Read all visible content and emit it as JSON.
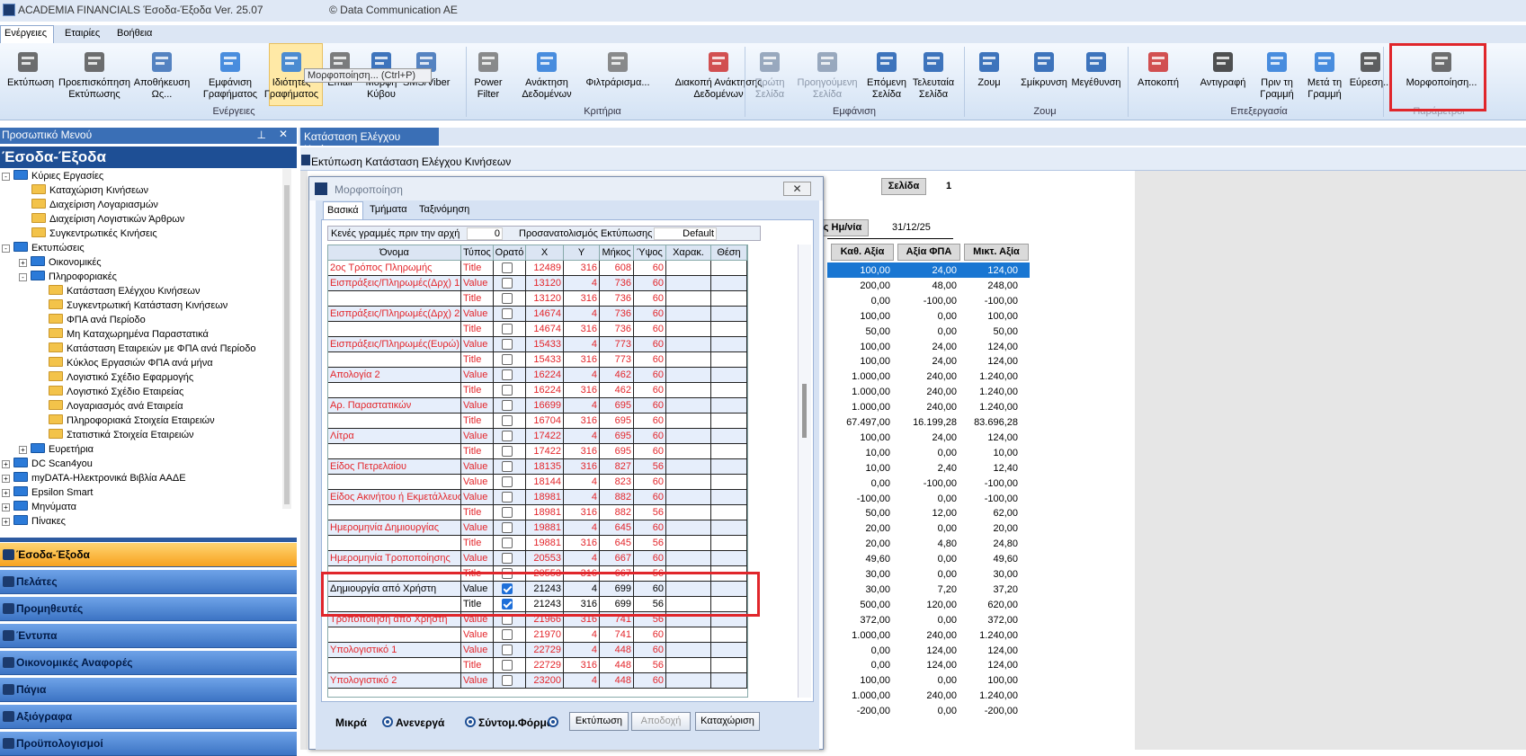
{
  "titlebar": {
    "title": "ACADEMIA FINANCIALS Έσοδα-Έξοδα Ver. 25.07",
    "copyright": "© Data Communication AE"
  },
  "menu": [
    "Ενέργειες",
    "Εταιρίες",
    "Βοήθεια"
  ],
  "ribbon": {
    "buttons": [
      {
        "label1": "Εκτύπωση",
        "label2": "",
        "icon": "printer-icon"
      },
      {
        "label1": "Προεπισκόπηση",
        "label2": "Εκτύπωσης",
        "icon": "print-preview-icon"
      },
      {
        "label1": "Αποθήκευση",
        "label2": "Ως...",
        "icon": "save-as-icon"
      },
      {
        "label1": "Εμφάνιση",
        "label2": "Γραφήματος",
        "icon": "bar-chart-icon"
      },
      {
        "label1": "Ιδιότητες",
        "label2": "Γραφήματος",
        "icon": "chart-properties-icon"
      },
      {
        "label1": "Email",
        "label2": "",
        "icon": "email-icon"
      },
      {
        "label1": "Μορφή",
        "label2": "Κύβου",
        "icon": "cube-icon"
      },
      {
        "label1": "SMS/Viber",
        "label2": "",
        "icon": "sms-icon"
      },
      {
        "label1": "Power",
        "label2": "Filter",
        "icon": "power-filter-icon"
      },
      {
        "label1": "Ανάκτηση",
        "label2": "Δεδομένων",
        "icon": "data-recovery-icon"
      },
      {
        "label1": "Φιλτράρισμα...",
        "label2": "",
        "icon": "filter-icon"
      },
      {
        "label1": "Διακοπή Ανάκτησης",
        "label2": "Δεδομένων",
        "icon": "stop-recovery-icon"
      },
      {
        "label1": "Πρώτη",
        "label2": "Σελίδα",
        "icon": "first-page-icon"
      },
      {
        "label1": "Προηγούμενη",
        "label2": "Σελίδα",
        "icon": "previous-page-icon"
      },
      {
        "label1": "Επόμενη",
        "label2": "Σελίδα",
        "icon": "next-page-icon"
      },
      {
        "label1": "Τελευταία",
        "label2": "Σελίδα",
        "icon": "last-page-icon"
      },
      {
        "label1": "Ζουμ",
        "label2": "",
        "icon": "zoom-icon"
      },
      {
        "label1": "Σμίκρυνση",
        "label2": "",
        "icon": "zoom-out-icon"
      },
      {
        "label1": "Μεγέθυνση",
        "label2": "",
        "icon": "zoom-in-icon"
      },
      {
        "label1": "Αποκοπή",
        "label2": "",
        "icon": "cut-icon"
      },
      {
        "label1": "Αντιγραφή",
        "label2": "",
        "icon": "copy-icon"
      },
      {
        "label1": "Πριν τη",
        "label2": "Γραμμή",
        "icon": "insert-before-icon"
      },
      {
        "label1": "Μετά τη",
        "label2": "Γραμμή",
        "icon": "insert-after-icon"
      },
      {
        "label1": "Εύρεση...",
        "label2": "",
        "icon": "find-icon"
      },
      {
        "label1": "Μορφοποίηση...",
        "label2": "",
        "icon": "format-icon"
      }
    ],
    "groups": [
      "Ενέργειες",
      "Κριτήρια",
      "Εμφάνιση",
      "Ζουμ",
      "Επεξεργασία",
      "Παράμετροι"
    ],
    "tooltip": "Μορφοποίηση... (Ctrl+P)"
  },
  "leftpanel": {
    "header": "Προσωπικό Μενού",
    "title": "Έσοδα-Έξοδα",
    "tree": [
      "Κύριες Εργασίες",
      "Καταχώριση Κινήσεων",
      "Διαχείριση Λογαριασμών",
      "Διαχείριση Λογιστικών Άρθρων",
      "Συγκεντρωτικές Κινήσεις",
      "Εκτυπώσεις",
      "Οικονομικές",
      "Πληροφοριακές",
      "Κατάσταση Ελέγχου Κινήσεων",
      "Συγκεντρωτική Κατάσταση Κινήσεων",
      "ΦΠΑ ανά Περίοδο",
      "Μη Καταχωρημένα Παραστατικά",
      "Κατάσταση Εταιρειών με ΦΠΑ ανά Περίοδο",
      "Κύκλος Εργασιών ΦΠΑ ανά μήνα",
      "Λογιστικό Σχέδιο Εφαρμογής",
      "Λογιστικό Σχέδιο Εταιρείας",
      "Λογαριασμός ανά Εταιρεία",
      "Πληροφοριακά Στοιχεία Εταιρειών",
      "Στατιστικά Στοιχεία Εταιρειών",
      "Ευρετήρια",
      "DC Scan4you",
      "myDATA-Ηλεκτρονικά Βιβλία ΑΑΔΕ",
      "Epsilon Smart",
      "Μηνύματα",
      "Πίνακες"
    ],
    "nav": [
      "Έσοδα-Έξοδα",
      "Πελάτες",
      "Προμηθευτές",
      "Έντυπα",
      "Οικονομικές Αναφορές",
      "Πάγια",
      "Αξιόγραφα",
      "Προϋπολογισμοί"
    ]
  },
  "main": {
    "tab": "Κατάσταση Ελέγχου Κινήσεων",
    "doctitle": "Εκτύπωση Κατάσταση Ελέγχου Κινήσεων",
    "report": {
      "page_label": "Σελίδα",
      "page_no": "1",
      "date_label": "ς Ημ/νία",
      "date": "31/12/25",
      "headers": [
        "Καθ. Αξία",
        "Αξία ΦΠΑ",
        "Μικτ. Αξία"
      ],
      "rows": [
        [
          "100,00",
          "24,00",
          "124,00"
        ],
        [
          "200,00",
          "48,00",
          "248,00"
        ],
        [
          "0,00",
          "-100,00",
          "-100,00"
        ],
        [
          "100,00",
          "0,00",
          "100,00"
        ],
        [
          "50,00",
          "0,00",
          "50,00"
        ],
        [
          "100,00",
          "24,00",
          "124,00"
        ],
        [
          "100,00",
          "24,00",
          "124,00"
        ],
        [
          "1.000,00",
          "240,00",
          "1.240,00"
        ],
        [
          "1.000,00",
          "240,00",
          "1.240,00"
        ],
        [
          "1.000,00",
          "240,00",
          "1.240,00"
        ],
        [
          "67.497,00",
          "16.199,28",
          "83.696,28"
        ],
        [
          "100,00",
          "24,00",
          "124,00"
        ],
        [
          "10,00",
          "0,00",
          "10,00"
        ],
        [
          "10,00",
          "2,40",
          "12,40"
        ],
        [
          "0,00",
          "-100,00",
          "-100,00"
        ],
        [
          "-100,00",
          "0,00",
          "-100,00"
        ],
        [
          "50,00",
          "12,00",
          "62,00"
        ],
        [
          "20,00",
          "0,00",
          "20,00"
        ],
        [
          "20,00",
          "4,80",
          "24,80"
        ],
        [
          "49,60",
          "0,00",
          "49,60"
        ],
        [
          "30,00",
          "0,00",
          "30,00"
        ],
        [
          "30,00",
          "7,20",
          "37,20"
        ],
        [
          "500,00",
          "120,00",
          "620,00"
        ],
        [
          "372,00",
          "0,00",
          "372,00"
        ],
        [
          "1.000,00",
          "240,00",
          "1.240,00"
        ],
        [
          "0,00",
          "124,00",
          "124,00"
        ],
        [
          "0,00",
          "124,00",
          "124,00"
        ],
        [
          "100,00",
          "0,00",
          "100,00"
        ],
        [
          "1.000,00",
          "240,00",
          "1.240,00"
        ],
        [
          "-200,00",
          "0,00",
          "-200,00"
        ]
      ]
    }
  },
  "dialog": {
    "title": "Μορφοποίηση",
    "tabs": [
      "Βασικά",
      "Τμήματα",
      "Ταξινόμηση"
    ],
    "blank_lines_label": "Κενές γραμμές πριν την αρχή",
    "blank_lines_value": "0",
    "orientation_label": "Προσανατολισμός Εκτύπωσης",
    "orientation_value": "Default",
    "columns": [
      "Όνομα",
      "Τύπος",
      "Ορατό",
      "X",
      "Y",
      "Μήκος",
      "Ύψος",
      "Χαρακ.",
      "Θέση"
    ],
    "rows": [
      {
        "name": "2ος Τρόπος Πληρωμής",
        "type": "Title",
        "vis": false,
        "x": "12489",
        "y": "316",
        "len": "608",
        "h": "60"
      },
      {
        "name": "Εισπράξεις/Πληρωμές(Δρχ) 1",
        "type": "Value",
        "vis": false,
        "x": "13120",
        "y": "4",
        "len": "736",
        "h": "60"
      },
      {
        "name": "",
        "type": "Title",
        "vis": false,
        "x": "13120",
        "y": "316",
        "len": "736",
        "h": "60"
      },
      {
        "name": "Εισπράξεις/Πληρωμές(Δρχ) 2",
        "type": "Value",
        "vis": false,
        "x": "14674",
        "y": "4",
        "len": "736",
        "h": "60"
      },
      {
        "name": "",
        "type": "Title",
        "vis": false,
        "x": "14674",
        "y": "316",
        "len": "736",
        "h": "60"
      },
      {
        "name": "Εισπράξεις/Πληρωμές(Ευρώ) 1",
        "type": "Value",
        "vis": false,
        "x": "15433",
        "y": "4",
        "len": "773",
        "h": "60"
      },
      {
        "name": "",
        "type": "Title",
        "vis": false,
        "x": "15433",
        "y": "316",
        "len": "773",
        "h": "60"
      },
      {
        "name": "Απολογία 2",
        "type": "Value",
        "vis": false,
        "x": "16224",
        "y": "4",
        "len": "462",
        "h": "60"
      },
      {
        "name": "",
        "type": "Title",
        "vis": false,
        "x": "16224",
        "y": "316",
        "len": "462",
        "h": "60"
      },
      {
        "name": "Αρ. Παραστατικών",
        "type": "Value",
        "vis": false,
        "x": "16699",
        "y": "4",
        "len": "695",
        "h": "60"
      },
      {
        "name": "",
        "type": "Title",
        "vis": false,
        "x": "16704",
        "y": "316",
        "len": "695",
        "h": "60"
      },
      {
        "name": "Λίτρα",
        "type": "Value",
        "vis": false,
        "x": "17422",
        "y": "4",
        "len": "695",
        "h": "60"
      },
      {
        "name": "",
        "type": "Title",
        "vis": false,
        "x": "17422",
        "y": "316",
        "len": "695",
        "h": "60"
      },
      {
        "name": "Είδος Πετρελαίου",
        "type": "Value",
        "vis": false,
        "x": "18135",
        "y": "316",
        "len": "827",
        "h": "56"
      },
      {
        "name": "",
        "type": "Value",
        "vis": false,
        "x": "18144",
        "y": "4",
        "len": "823",
        "h": "60"
      },
      {
        "name": "Είδος Ακινήτου ή Εκμετάλλευσης",
        "type": "Value",
        "vis": false,
        "x": "18981",
        "y": "4",
        "len": "882",
        "h": "60"
      },
      {
        "name": "",
        "type": "Title",
        "vis": false,
        "x": "18981",
        "y": "316",
        "len": "882",
        "h": "56"
      },
      {
        "name": "Ημερομηνία Δημιουργίας",
        "type": "Value",
        "vis": false,
        "x": "19881",
        "y": "4",
        "len": "645",
        "h": "60"
      },
      {
        "name": "",
        "type": "Title",
        "vis": false,
        "x": "19881",
        "y": "316",
        "len": "645",
        "h": "56"
      },
      {
        "name": "Ημερομηνία Τροποποίησης",
        "type": "Value",
        "vis": false,
        "x": "20553",
        "y": "4",
        "len": "667",
        "h": "60"
      },
      {
        "name": "",
        "type": "Title",
        "vis": false,
        "x": "20553",
        "y": "316",
        "len": "667",
        "h": "56"
      },
      {
        "name": "Δημιουργία από Χρήστη",
        "type": "Value",
        "vis": true,
        "x": "21243",
        "y": "4",
        "len": "699",
        "h": "60"
      },
      {
        "name": "",
        "type": "Title",
        "vis": true,
        "x": "21243",
        "y": "316",
        "len": "699",
        "h": "56"
      },
      {
        "name": "Τροποποίηση από Χρήστη",
        "type": "Value",
        "vis": false,
        "x": "21966",
        "y": "316",
        "len": "741",
        "h": "56"
      },
      {
        "name": "",
        "type": "Value",
        "vis": false,
        "x": "21970",
        "y": "4",
        "len": "741",
        "h": "60"
      },
      {
        "name": "Υπολογιστικό 1",
        "type": "Value",
        "vis": false,
        "x": "22729",
        "y": "4",
        "len": "448",
        "h": "60"
      },
      {
        "name": "",
        "type": "Title",
        "vis": false,
        "x": "22729",
        "y": "316",
        "len": "448",
        "h": "56"
      },
      {
        "name": "Υπολογιστικό 2",
        "type": "Value",
        "vis": false,
        "x": "23200",
        "y": "4",
        "len": "448",
        "h": "60"
      }
    ],
    "bottom": {
      "size_label": "Μικρά",
      "radio1": "Ανενεργά",
      "radio2": "Σύντομ.Φόρμα",
      "print_btn": "Εκτύπωση",
      "save_btn": "Αποδοχή",
      "register_btn": "Καταχώριση"
    }
  }
}
